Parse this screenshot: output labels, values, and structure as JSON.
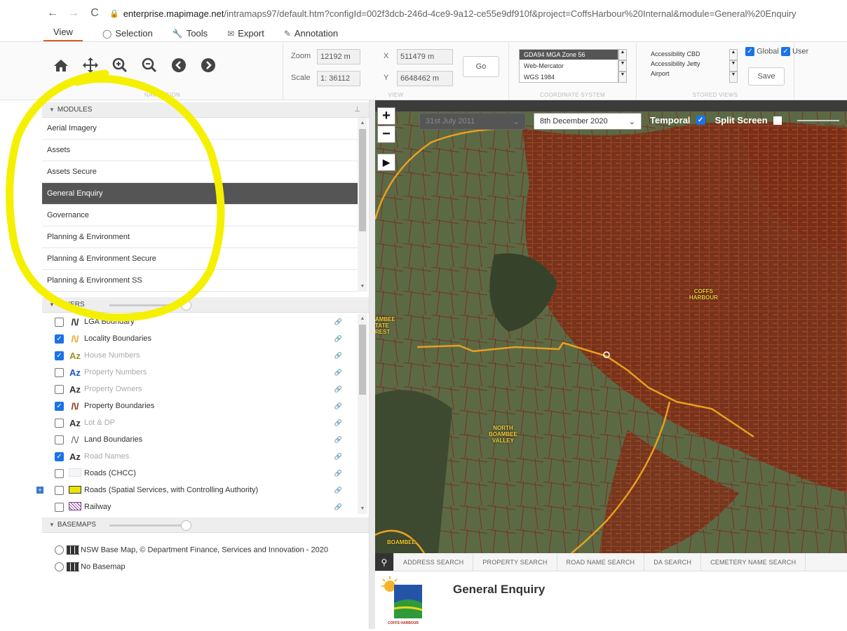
{
  "browser": {
    "back": "←",
    "forward": "→",
    "reload": "C",
    "url_host": "enterprise.mapimage.net",
    "url_path": "/intramaps97/default.htm?configId=002f3dcb-246d-4ce9-9a12-ce55e9df910f&project=CoffsHarbour%20Internal&module=General%20Enquiry"
  },
  "menu": {
    "tabs": [
      {
        "label": "View",
        "icon": ""
      },
      {
        "label": "Selection",
        "icon": "selection-icon"
      },
      {
        "label": "Tools",
        "icon": "wrench-icon"
      },
      {
        "label": "Export",
        "icon": "envelope-icon"
      },
      {
        "label": "Annotation",
        "icon": "pencil-icon"
      }
    ]
  },
  "ribbon": {
    "navigation_label": "NAVIGATION",
    "view_label": "VIEW",
    "coord_label": "COORDINATE SYSTEM",
    "stored_label": "STORED VIEWS",
    "zoom_label": "Zoom",
    "zoom_value": "12192 m",
    "scale_label": "Scale",
    "scale_value": "1: 36112",
    "x_label": "X",
    "x_value": "511479 m",
    "y_label": "Y",
    "y_value": "6648462 m",
    "go_label": "Go",
    "coord_systems": [
      "GDA94 MGA Zone 56",
      "Web-Mercator",
      "WGS 1984"
    ],
    "stored_views": [
      "Accessibility CBD",
      "Accessibility Jetty",
      "Airport"
    ],
    "global_label": "Global",
    "user_label": "User",
    "save_label": "Save"
  },
  "modules": {
    "title": "MODULES",
    "items": [
      "Aerial Imagery",
      "Assets",
      "Assets Secure",
      "General Enquiry",
      "Governance",
      "Planning & Environment",
      "Planning & Environment Secure",
      "Planning & Environment SS"
    ],
    "active": "General Enquiry"
  },
  "layers": {
    "title": "LAYERS",
    "items": [
      {
        "label": "LGA Boundary",
        "checked": false,
        "dim": false
      },
      {
        "label": "Locality Boundaries",
        "checked": true,
        "dim": false
      },
      {
        "label": "House Numbers",
        "checked": true,
        "dim": true
      },
      {
        "label": "Property Numbers",
        "checked": false,
        "dim": true
      },
      {
        "label": "Property Owners",
        "checked": false,
        "dim": true
      },
      {
        "label": "Property Boundaries",
        "checked": true,
        "dim": false
      },
      {
        "label": "Lot & DP",
        "checked": false,
        "dim": true
      },
      {
        "label": "Land Boundaries",
        "checked": false,
        "dim": false
      },
      {
        "label": "Road Names",
        "checked": true,
        "dim": true
      },
      {
        "label": "Roads (CHCC)",
        "checked": false,
        "dim": false
      },
      {
        "label": "Roads (Spatial Services, with Controlling Authority)",
        "checked": false,
        "dim": false
      },
      {
        "label": "Railway",
        "checked": false,
        "dim": false
      }
    ]
  },
  "basemaps": {
    "title": "BASEMAPS",
    "items": [
      "NSW Base Map, © Department Finance, Services and Innovation - 2020",
      "No Basemap"
    ]
  },
  "map": {
    "zoom_in": "+",
    "zoom_out": "−",
    "date_from": "31st July 2011",
    "date_to": "8th December 2020",
    "temporal_label": "Temporal",
    "split_label": "Split Screen",
    "labels": {
      "coffs": "COFFS\nHARBOUR",
      "boambee_forest": "AMBEE\nTATE\nREST",
      "north_boambee": "NORTH\nBOAMBEE\nVALLEY",
      "boambee": "BOAMBEE"
    }
  },
  "search": {
    "tabs": [
      "ADDRESS SEARCH",
      "PROPERTY SEARCH",
      "ROAD NAME SEARCH",
      "DA SEARCH",
      "CEMETERY NAME SEARCH"
    ]
  },
  "enquiry": {
    "title": "General Enquiry",
    "logo_text": "COFFS HARBOUR"
  },
  "colors": {
    "accent": "#e05d1f",
    "checkbox": "#1a73e8",
    "annotation": "#f4f000",
    "property_lines": "#8b2a12",
    "boundary_line": "#e9a020"
  }
}
